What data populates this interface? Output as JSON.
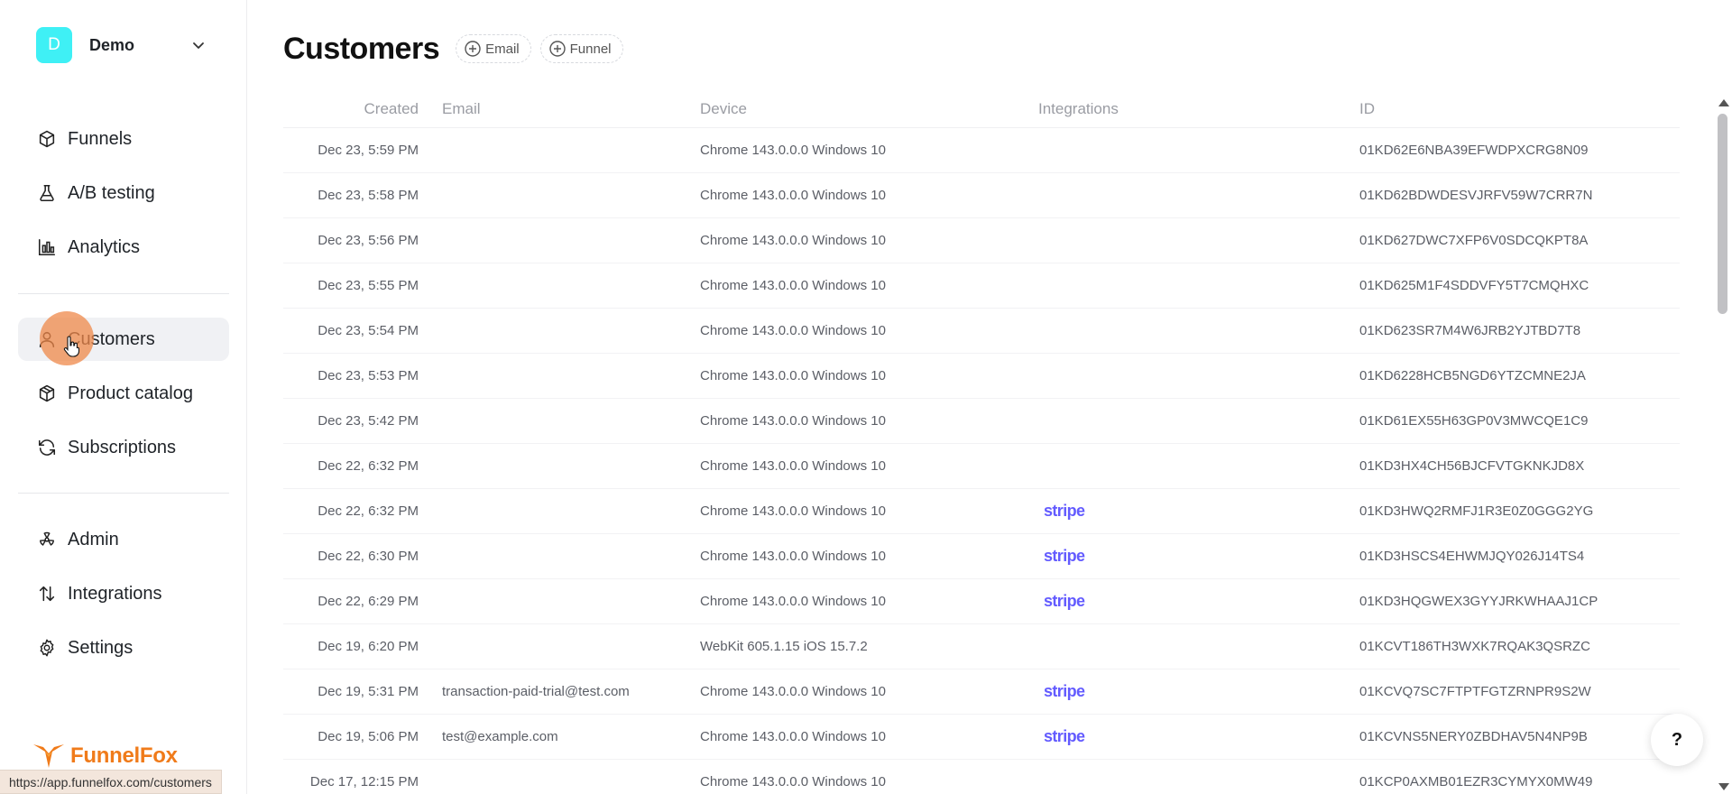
{
  "workspace": {
    "initial": "D",
    "name": "Demo"
  },
  "nav": {
    "group1": [
      {
        "label": "Funnels",
        "icon": "cube-icon"
      },
      {
        "label": "A/B testing",
        "icon": "flask-icon"
      },
      {
        "label": "Analytics",
        "icon": "bar-chart-icon"
      }
    ],
    "group2": [
      {
        "label": "Customers",
        "icon": "user-icon",
        "active": true
      },
      {
        "label": "Product catalog",
        "icon": "package-icon"
      },
      {
        "label": "Subscriptions",
        "icon": "refresh-icon"
      }
    ],
    "group3": [
      {
        "label": "Admin",
        "icon": "admin-icon"
      },
      {
        "label": "Integrations",
        "icon": "arrows-updown-icon"
      },
      {
        "label": "Settings",
        "icon": "gear-icon"
      }
    ]
  },
  "brand": {
    "name": "FunnelFox",
    "color": "#f07b1a"
  },
  "status_bar": {
    "url": "https://app.funnelfox.com/customers"
  },
  "header": {
    "title": "Customers",
    "filters": [
      "Email",
      "Funnel"
    ]
  },
  "table": {
    "columns": [
      "Created",
      "Email",
      "Device",
      "Integrations",
      "ID"
    ],
    "rows": [
      {
        "created": "Dec 23, 5:59 PM",
        "email": "",
        "device": "Chrome 143.0.0.0 Windows 10",
        "integration": "",
        "id": "01KD62E6NBA39EFWDPXCRG8N09"
      },
      {
        "created": "Dec 23, 5:58 PM",
        "email": "",
        "device": "Chrome 143.0.0.0 Windows 10",
        "integration": "",
        "id": "01KD62BDWDESVJRFV59W7CRR7N"
      },
      {
        "created": "Dec 23, 5:56 PM",
        "email": "",
        "device": "Chrome 143.0.0.0 Windows 10",
        "integration": "",
        "id": "01KD627DWC7XFP6V0SDCQKPT8A"
      },
      {
        "created": "Dec 23, 5:55 PM",
        "email": "",
        "device": "Chrome 143.0.0.0 Windows 10",
        "integration": "",
        "id": "01KD625M1F4SDDVFY5T7CMQHXC"
      },
      {
        "created": "Dec 23, 5:54 PM",
        "email": "",
        "device": "Chrome 143.0.0.0 Windows 10",
        "integration": "",
        "id": "01KD623SR7M4W6JRB2YJTBD7T8"
      },
      {
        "created": "Dec 23, 5:53 PM",
        "email": "",
        "device": "Chrome 143.0.0.0 Windows 10",
        "integration": "",
        "id": "01KD6228HCB5NGD6YTZCMNE2JA"
      },
      {
        "created": "Dec 23, 5:42 PM",
        "email": "",
        "device": "Chrome 143.0.0.0 Windows 10",
        "integration": "",
        "id": "01KD61EX55H63GP0V3MWCQE1C9"
      },
      {
        "created": "Dec 22, 6:32 PM",
        "email": "",
        "device": "Chrome 143.0.0.0 Windows 10",
        "integration": "",
        "id": "01KD3HX4CH56BJCFVTGKNKJD8X"
      },
      {
        "created": "Dec 22, 6:32 PM",
        "email": "",
        "device": "Chrome 143.0.0.0 Windows 10",
        "integration": "stripe",
        "id": "01KD3HWQ2RMFJ1R3E0Z0GGG2YG"
      },
      {
        "created": "Dec 22, 6:30 PM",
        "email": "",
        "device": "Chrome 143.0.0.0 Windows 10",
        "integration": "stripe",
        "id": "01KD3HSCS4EHWMJQY026J14TS4"
      },
      {
        "created": "Dec 22, 6:29 PM",
        "email": "",
        "device": "Chrome 143.0.0.0 Windows 10",
        "integration": "stripe",
        "id": "01KD3HQGWEX3GYYJRKWHAAJ1CP"
      },
      {
        "created": "Dec 19, 6:20 PM",
        "email": "",
        "device": "WebKit 605.1.15 iOS 15.7.2",
        "integration": "",
        "id": "01KCVT186TH3WXK7RQAK3QSRZC"
      },
      {
        "created": "Dec 19, 5:31 PM",
        "email": "transaction-paid-trial@test.com",
        "device": "Chrome 143.0.0.0 Windows 10",
        "integration": "stripe",
        "id": "01KCVQ7SC7FTPTFGTZRNPR9S2W"
      },
      {
        "created": "Dec 19, 5:06 PM",
        "email": "test@example.com",
        "device": "Chrome 143.0.0.0 Windows 10",
        "integration": "stripe",
        "id": "01KCVNS5NERY0ZBDHAV5N4NP9B"
      },
      {
        "created": "Dec 17, 12:15 PM",
        "email": "",
        "device": "Chrome 143.0.0.0 Windows 10",
        "integration": "",
        "id": "01KCP0AXMB01EZR3CYMYX0MW49"
      }
    ]
  },
  "help": {
    "label": "?"
  },
  "colors": {
    "accent_cyan": "#3ff0f5",
    "stripe": "#635bff",
    "cursor_halo": "#ef884a"
  }
}
